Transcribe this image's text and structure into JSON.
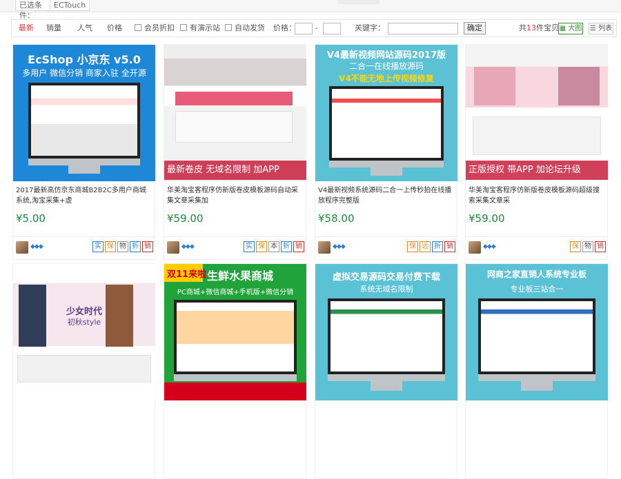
{
  "breadcrumbs": [
    "已选条件：",
    "ECTouch"
  ],
  "filter": {
    "tabs": [
      "最新",
      "销量",
      "人气",
      "价格"
    ],
    "checkboxes": [
      "会员折扣",
      "有演示站",
      "自动发货"
    ],
    "price_label": "价格：",
    "price_separator": "-",
    "keyword_label": "关键字：",
    "keyword_value": "",
    "ok_label": "确定",
    "count_prefix": "共",
    "count_value": "13",
    "count_suffix": "件宝贝",
    "view_large": "大图",
    "view_list": "列表"
  },
  "colors": {
    "accent": "#e4393c",
    "price": "#1a8a3a",
    "active_view": "#3b8c3b"
  },
  "products": [
    {
      "thumb_texts": [
        "EcShop 小京东 v5.0",
        "多用户 微信分销 商家入驻 全开源"
      ],
      "title": "2017最新高仿京东商城B2B2C多用户商城系统,淘宝采集+虚",
      "price": "¥5.00",
      "badges": [
        "实",
        "保",
        "物",
        "折",
        "销"
      ]
    },
    {
      "thumb_texts": [
        "最新卷皮  无域名限制  加APP"
      ],
      "title": "华美淘宝客程序仿新版卷皮模板源码自动采集文章采集加",
      "price": "¥59.00",
      "badges": [
        "实",
        "保",
        "本",
        "折",
        "销"
      ]
    },
    {
      "thumb_texts": [
        "V4最新视频网站源码2017版",
        "二合一在线播放源码",
        "V4不能无地上传视频修复"
      ],
      "title": "V4最新视频系统源码二合一上传秒拍在线播放程序完整版",
      "price": "¥58.00",
      "badges": [
        "保",
        "远",
        "折",
        "销"
      ]
    },
    {
      "thumb_texts": [
        "正版授权  带APP  加论坛升级"
      ],
      "title": "华美淘宝客程序仿新版卷皮模板源码超级搜索采集文章采",
      "price": "¥59.00",
      "badges": [
        "保",
        "物",
        "销"
      ]
    },
    {
      "thumb_texts": [
        "少女时代",
        "初秋style"
      ],
      "title": "",
      "price": "",
      "badges": []
    },
    {
      "thumb_texts": [
        "双11来啦",
        "生鲜水果商城",
        "PC商城+微信商城+手机版+微信分销"
      ],
      "title": "",
      "price": "",
      "badges": []
    },
    {
      "thumb_texts": [
        "虚拟交易源码交易付费下载",
        "系统无域名限制"
      ],
      "title": "",
      "price": "",
      "badges": []
    },
    {
      "thumb_texts": [
        "网商之家直销人系统专业板",
        "专业板三站合一"
      ],
      "title": "",
      "price": "",
      "badges": []
    }
  ]
}
